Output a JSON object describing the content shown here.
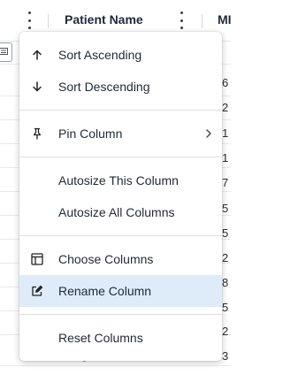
{
  "header": {
    "column_title": "Patient Name",
    "next_column_fragment": "MI"
  },
  "grid_fragments": {
    "right_column": [
      "6",
      "2",
      "1",
      "1",
      "7",
      "5",
      "5",
      "2",
      "8",
      "5",
      "2",
      "3"
    ],
    "left_name_fragment": "g"
  },
  "menu": {
    "items": [
      {
        "label": "Sort Ascending",
        "icon": "arrow-up-icon"
      },
      {
        "label": "Sort Descending",
        "icon": "arrow-down-icon"
      },
      {
        "label": "Pin Column",
        "icon": "pin-icon",
        "has_submenu": true
      },
      {
        "label": "Autosize This Column",
        "icon": ""
      },
      {
        "label": "Autosize All Columns",
        "icon": ""
      },
      {
        "label": "Choose Columns",
        "icon": "columns-icon"
      },
      {
        "label": "Rename Column",
        "icon": "edit-icon",
        "active": true
      },
      {
        "label": "Reset Columns",
        "icon": ""
      }
    ]
  },
  "colors": {
    "active_item_bg": "#ddecf8",
    "text": "#1f2937"
  }
}
